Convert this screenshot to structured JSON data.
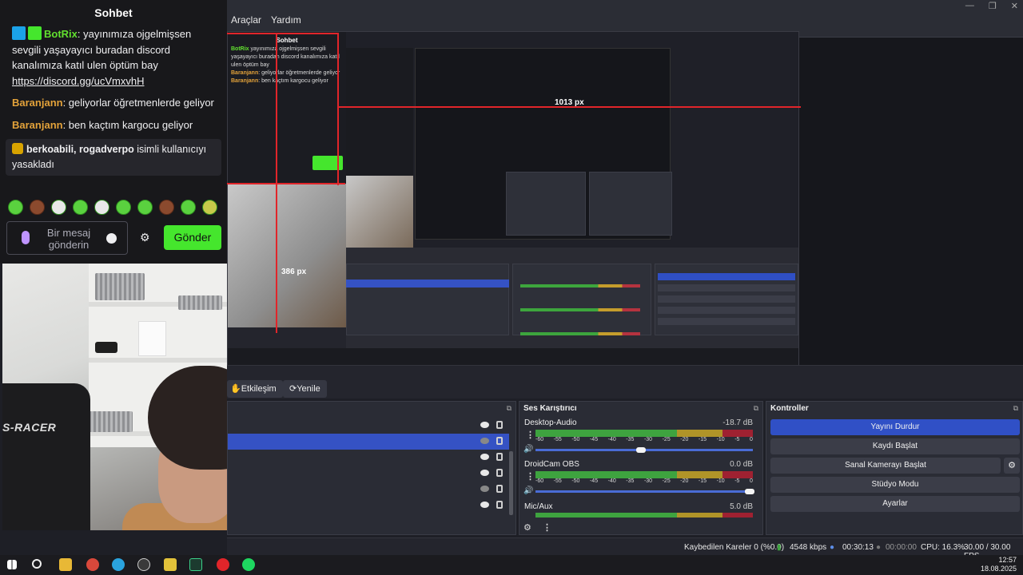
{
  "obs": {
    "menu": [
      "Araçlar",
      "Yardım"
    ],
    "window_controls": [
      "—",
      "❐",
      "✕"
    ]
  },
  "chat": {
    "title": "Sohbet",
    "messages": [
      {
        "user": "BotRix",
        "user_color": "#62e02f",
        "text": ": yayınımıza ojgelmişsen sevgili yaşayayıcı buradan discord kanalımıza katıl ulen öptüm bay",
        "link": "https://discord.gg/ucVmxvhH"
      },
      {
        "user": "Baranjann",
        "user_color": "#e3a23a",
        "text": ": geliyorlar öğretmenlerde geliyor"
      },
      {
        "user": "Baranjann",
        "user_color": "#e3a23a",
        "text": ": ben kaçtım kargocu geliyor"
      }
    ],
    "ban_notice": {
      "users": "berkoabili, rogadverpo",
      "text": " isimli kullanıcıyı yasakladı"
    },
    "input_placeholder": "Bir mesaj gönderin",
    "send_label": "Gönder",
    "emote_count": 10
  },
  "webcam": {
    "chair_brand": "S-RACER"
  },
  "preview": {
    "nested_chat_title": "Sohbet",
    "measure_width": "1013 px",
    "measure_height": "386 px"
  },
  "controls_bar": {
    "interact_label": "Etkileşim",
    "refresh_label": "Yenile"
  },
  "mixer": {
    "title": "Ses Karıştırıcı",
    "ticks": [
      "-60",
      "-55",
      "-50",
      "-45",
      "-40",
      "-35",
      "-30",
      "-25",
      "-20",
      "-15",
      "-10",
      "-5",
      "0"
    ],
    "channels": [
      {
        "name": "Desktop-Audio",
        "db": "-18.7 dB",
        "volume": 0.5
      },
      {
        "name": "DroidCam OBS",
        "db": "0.0 dB",
        "volume": 1.0
      },
      {
        "name": "Mic/Aux",
        "db": "5.0 dB",
        "volume": 1.0
      }
    ]
  },
  "controls": {
    "title": "Kontroller",
    "buttons": [
      "Yayını Durdur",
      "Kaydı Başlat",
      "Sanal Kamerayı Başlat",
      "Stüdyo Modu",
      "Ayarlar"
    ]
  },
  "status": {
    "dropped_frames": "Kaybedilen Kareler 0 (%0.0)",
    "bitrate": "4548 kbps",
    "stream_time": "00:30:13",
    "record_time": "00:00:00",
    "cpu": "CPU: 16.3%",
    "fps": "30.00 / 30.00 FPS"
  },
  "taskbar": {
    "time": "12:57",
    "date": "18.08.2025"
  },
  "colors": {
    "accent_blue": "#3050c6",
    "send_green": "#45e62d",
    "measure_red": "#e1252a"
  }
}
